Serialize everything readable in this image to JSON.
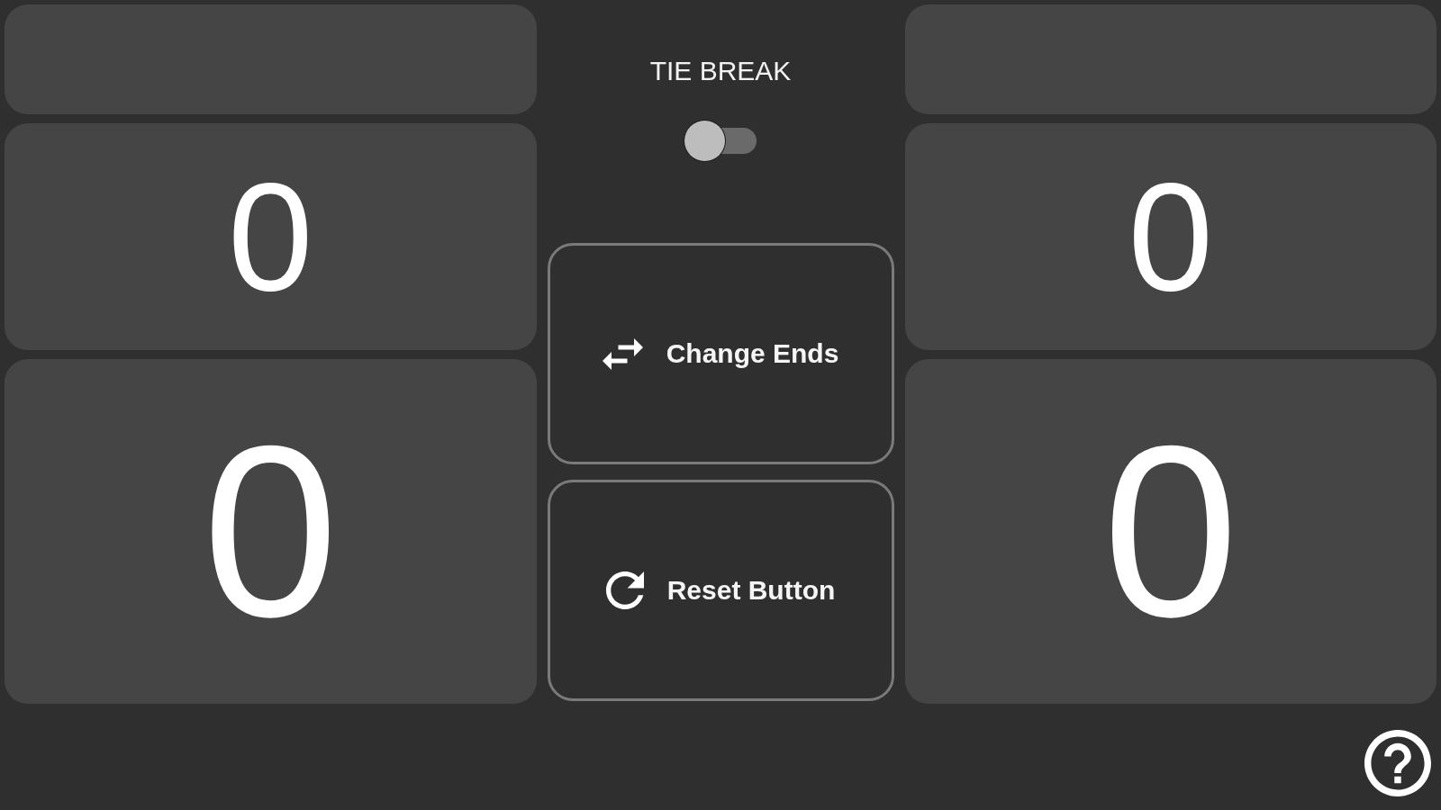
{
  "sides": [
    {
      "upper_score": "0",
      "lower_score": "0"
    },
    {
      "upper_score": "0",
      "lower_score": "0"
    }
  ],
  "tie_break": {
    "label": "TIE BREAK",
    "on": false
  },
  "buttons": [
    {
      "kind": "swap",
      "label": "Change Ends"
    },
    {
      "kind": "reset",
      "label": "Reset Button"
    }
  ]
}
